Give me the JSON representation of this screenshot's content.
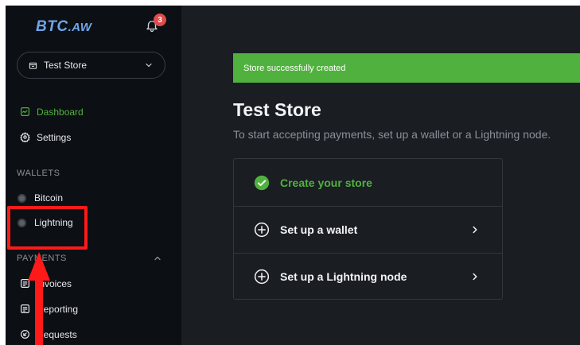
{
  "brand": {
    "name": "BTC",
    "suffix": ".AW"
  },
  "notifications": {
    "count": "3"
  },
  "store_selector": {
    "value": "Test Store"
  },
  "nav": {
    "dashboard": "Dashboard",
    "settings": "Settings",
    "wallets_label": "WALLETS",
    "bitcoin": "Bitcoin",
    "lightning": "Lightning",
    "payments_label": "PAYMENTS",
    "invoices": "Invoices",
    "reporting": "Reporting",
    "requests": "Requests"
  },
  "main": {
    "alert": "Store successfully created",
    "title": "Test Store",
    "subtitle": "To start accepting payments, set up a wallet or a Lightning node.",
    "steps": [
      {
        "label": "Create your store",
        "status": "done"
      },
      {
        "label": "Set up a wallet",
        "status": "todo"
      },
      {
        "label": "Set up a Lightning node",
        "status": "todo"
      }
    ]
  },
  "colors": {
    "accent_green": "#51b13e",
    "brand_blue": "#6ea6e9",
    "highlight_red": "#ff1a1a",
    "sidebar_bg": "#0c0f14",
    "main_bg": "#1a1d22"
  }
}
